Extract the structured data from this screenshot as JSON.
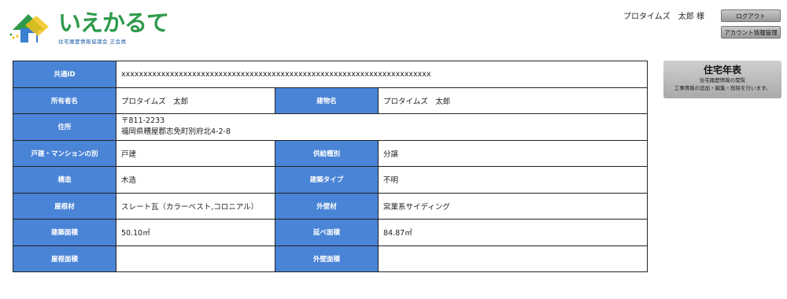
{
  "logo": {
    "title": "いえかるて",
    "subtitle": "住宅履歴情報協議会 正会員"
  },
  "header": {
    "user_name": "プロタイムズ　太郎 様",
    "logout_label": "ログアウト",
    "account_label": "アカウント情報管理"
  },
  "side_panel": {
    "title": "住宅年表",
    "desc1": "住宅履歴情報の閲覧",
    "desc2": "工事情報の追加・編集・削除を行います。"
  },
  "table": {
    "shared_id_label": "共通ID",
    "shared_id_value": "xxxxxxxxxxxxxxxxxxxxxxxxxxxxxxxxxxxxxxxxxxxxxxxxxxxxxxxxxxxxxxxxxxxxxx",
    "owner_label": "所有者名",
    "owner_value": "プロタイムズ　太郎",
    "building_label": "建物名",
    "building_value": "プロタイムズ　太郎",
    "address_label": "住所",
    "postal": "〒811-2233",
    "address": "福岡県糟屋郡志免町別府北4-2-8",
    "house_type_label": "戸建・マンションの別",
    "house_type_value": "戸建",
    "supply_label": "供給種別",
    "supply_value": "分譲",
    "structure_label": "構造",
    "structure_value": "木造",
    "build_type_label": "建築タイプ",
    "build_type_value": "不明",
    "roof_label": "屋根材",
    "roof_value": "スレート瓦（カラーベスト,コロニアル）",
    "wall_label": "外壁材",
    "wall_value": "窯業系サイディング",
    "building_area_label": "建築面積",
    "building_area_value": "50.10㎡",
    "floor_area_label": "延べ面積",
    "floor_area_value": "84.87㎡",
    "roof_area_label": "屋根面積",
    "roof_area_value": "",
    "wall_area_label": "外壁面積",
    "wall_area_value": ""
  },
  "colors": {
    "label_bg": "#4a84d6",
    "logo_green": "#2e9a4a",
    "logo_blue": "#1e5ea8"
  }
}
